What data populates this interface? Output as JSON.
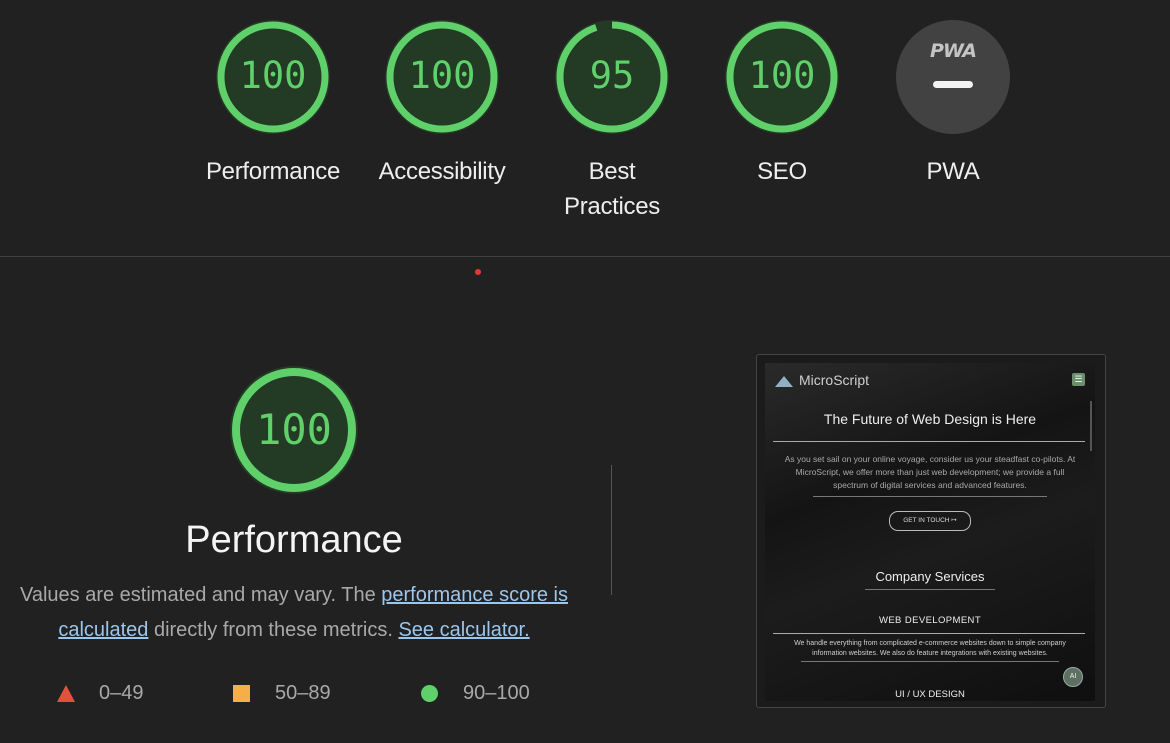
{
  "categories": [
    {
      "score": "100",
      "label": "Performance",
      "value": 100
    },
    {
      "score": "100",
      "label": "Accessibility",
      "value": 100
    },
    {
      "score": "95",
      "label_line1": "Best",
      "label_line2": "Practices",
      "value": 95
    },
    {
      "score": "100",
      "label": "SEO",
      "value": 100
    },
    {
      "badge": "PWA",
      "label": "PWA"
    }
  ],
  "colors": {
    "pass": "#5fd06a",
    "average": "#f6ae4a",
    "fail": "#e3503e",
    "link": "#9cc6ec"
  },
  "performance": {
    "score": "100",
    "value": 100,
    "title": "Performance",
    "desc_prefix": "Values are estimated and may vary. The ",
    "link_score": "performance score is calculated",
    "desc_middle": " directly from these metrics. ",
    "link_calc": "See calculator."
  },
  "legend": [
    {
      "icon": "triangle-icon",
      "range": "0–49"
    },
    {
      "icon": "square-icon",
      "range": "50–89"
    },
    {
      "icon": "circle-icon",
      "range": "90–100"
    }
  ],
  "screenshot": {
    "logo_text": "MicroScript",
    "hero_title": "The Future of Web Design is Here",
    "hero_text": "As you set sail on your online voyage, consider us your steadfast co-pilots. At MicroScript, we offer more than just web development; we provide a full spectrum of digital services and advanced features.",
    "cta": "GET IN TOUCH  ↦",
    "services_title": "Company Services",
    "web_dev_title": "WEB DEVELOPMENT",
    "web_dev_text": "We handle everything from complicated e-commerce websites down to simple company information websites. We also do feature integrations with existing websites.",
    "ai_badge": "AI",
    "uiux_title": "UI / UX DESIGN"
  }
}
